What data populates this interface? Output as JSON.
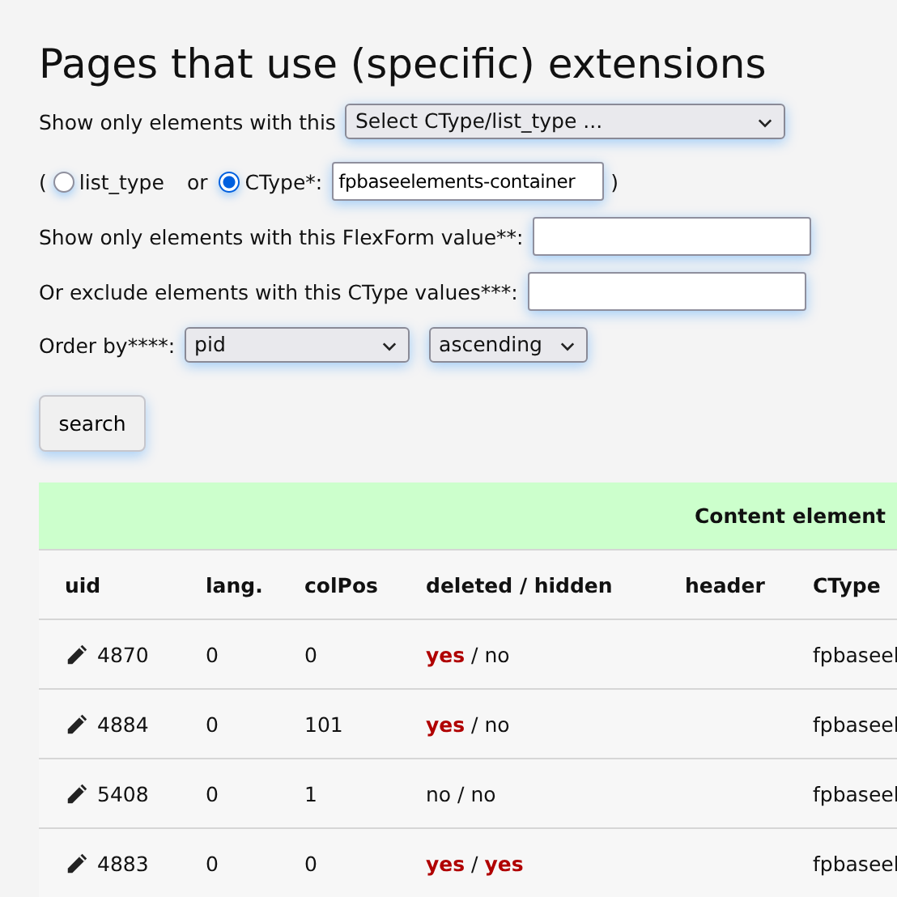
{
  "title": "Pages that use (specific) extensions",
  "filter": {
    "label": "Show only elements with this",
    "select": "Select CType/list_type ..."
  },
  "type_choice": {
    "open": "(",
    "or": "or",
    "close": ")",
    "value": "fpbaseelements-container",
    "options": [
      {
        "label": "list_type",
        "selected": false
      },
      {
        "label": "CType*:",
        "selected": true
      }
    ]
  },
  "flexform": {
    "label": "Show only elements with this FlexForm value**:"
  },
  "exclude": {
    "label": "Or exclude elements with this CType values***:"
  },
  "order": {
    "label": "Order by****:",
    "field": "pid",
    "direction": "ascending"
  },
  "search_button": "search",
  "table": {
    "group_header": "Content element",
    "columns": [
      "uid",
      "lang.",
      "colPos",
      "deleted / hidden",
      "header",
      "CType"
    ],
    "rows": [
      {
        "uid": "4870",
        "lang": "0",
        "colpos": "0",
        "deleted_hidden": "**yes** / no",
        "ctype": "fpbaseel"
      },
      {
        "uid": "4884",
        "lang": "0",
        "colpos": "101",
        "deleted_hidden": "**yes** / no",
        "ctype": "fpbaseel"
      },
      {
        "uid": "5408",
        "lang": "0",
        "colpos": "1",
        "deleted_hidden": "no / no",
        "ctype": "fpbaseel"
      },
      {
        "uid": "4883",
        "lang": "0",
        "colpos": "0",
        "deleted_hidden": "**yes** / **yes**",
        "ctype": "fpbaseel"
      }
    ]
  }
}
